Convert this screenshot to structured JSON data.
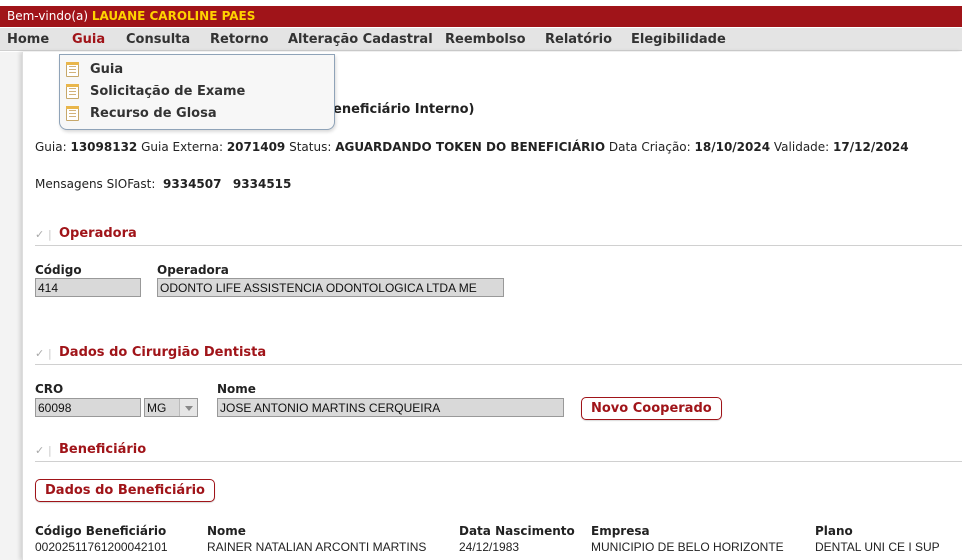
{
  "topbar": {
    "welcome_prefix": "Bem-vindo(a)",
    "user_name": "LAUANE CAROLINE PAES"
  },
  "menu": [
    {
      "label": "Home"
    },
    {
      "label": "Guia"
    },
    {
      "label": "Consulta"
    },
    {
      "label": "Retorno"
    },
    {
      "label": "Alteração Cadastral"
    },
    {
      "label": "Reembolso"
    },
    {
      "label": "Relatório"
    },
    {
      "label": "Elegibilidade"
    }
  ],
  "dropdown": [
    {
      "label": "Guia",
      "icon": "document-icon"
    },
    {
      "label": "Solicitação de Exame",
      "icon": "document-icon"
    },
    {
      "label": "Recurso de Glosa",
      "icon": "document-icon"
    }
  ],
  "page_title_visible": "eneficiário Interno)",
  "guide_info": {
    "guia_label": "Guia:",
    "guia_value": "13098132",
    "externa_label": "Guia Externa:",
    "externa_value": "2071409",
    "status_label": "Status:",
    "status_value": "AGUARDANDO TOKEN DO BENEFICIÁRIO",
    "criacao_label": "Data Criação:",
    "criacao_value": "18/10/2024",
    "validade_label": "Validade:",
    "validade_value": "17/12/2024"
  },
  "messages": {
    "label": "Mensagens SIOFast:",
    "values": [
      "9334507",
      "9334515"
    ]
  },
  "operadora": {
    "section_title": "Operadora",
    "codigo_label": "Código",
    "codigo_value": "414",
    "operadora_label": "Operadora",
    "operadora_value": "ODONTO LIFE ASSISTENCIA ODONTOLOGICA LTDA ME"
  },
  "dentista": {
    "section_title": "Dados do Cirurgião Dentista",
    "cro_label": "CRO",
    "cro_value": "60098",
    "uf_value": "MG",
    "nome_label": "Nome",
    "nome_value": "JOSE ANTONIO MARTINS CERQUEIRA",
    "novo_button": "Novo Cooperado"
  },
  "beneficiario": {
    "section_title": "Beneficiário",
    "dados_button": "Dados do Beneficiário",
    "headers": [
      "Código Beneficiário",
      "Nome",
      "Data Nascimento",
      "Empresa",
      "Plano"
    ],
    "values": [
      "00202511761200042101",
      "RAINER NATALIAN ARCONTI MARTINS",
      "24/12/1983",
      "MUNICIPIO DE BELO HORIZONTE",
      "DENTAL UNI CE I SUP"
    ]
  },
  "colors": {
    "brand_red": "#a01419",
    "welcome_yellow": "#ffd200"
  }
}
